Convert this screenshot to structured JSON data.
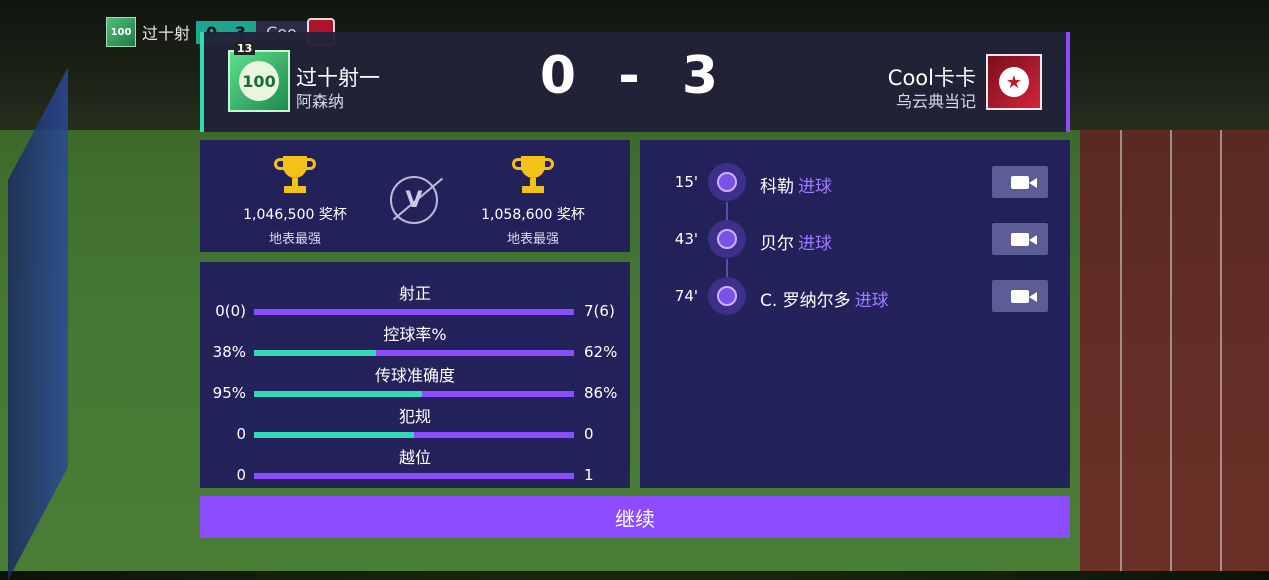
{
  "mini_bar": {
    "badge": "100",
    "home_name": "过十射",
    "score": "0 - 3",
    "away_name": "Coo"
  },
  "header": {
    "home": {
      "name": "过十射一",
      "club": "阿森纳",
      "badge_text": "100",
      "badge_rank": "13"
    },
    "score": "0 - 3",
    "away": {
      "name": "Cool卡卡",
      "club": "乌云典当记",
      "badge_symbol": "★"
    }
  },
  "trophies": {
    "home": {
      "count": "1,046,500 奖杯",
      "tier": "地表最强"
    },
    "vs_label": "V",
    "away": {
      "count": "1,058,600 奖杯",
      "tier": "地表最强"
    }
  },
  "stats": [
    {
      "label": "射正",
      "left": "0(0)",
      "right": "7(6)",
      "home_share": 0.0
    },
    {
      "label": "控球率%",
      "left": "38%",
      "right": "62%",
      "home_share": 0.38
    },
    {
      "label": "传球准确度",
      "left": "95%",
      "right": "86%",
      "home_share": 0.525
    },
    {
      "label": "犯规",
      "left": "0",
      "right": "0",
      "home_share": 0.5
    },
    {
      "label": "越位",
      "left": "0",
      "right": "1",
      "home_share": 0.0
    }
  ],
  "events": [
    {
      "minute": "15'",
      "player": "科勒",
      "type": "进球"
    },
    {
      "minute": "43'",
      "player": "贝尔",
      "type": "进球"
    },
    {
      "minute": "74'",
      "player": "C. 罗纳尔多",
      "type": "进球"
    }
  ],
  "continue_label": "继续",
  "colors": {
    "accent_purple": "#8b4dff",
    "accent_teal": "#34d9b6",
    "panel_bg": "#221e5c",
    "trophy_gold": "#f2c21a"
  }
}
